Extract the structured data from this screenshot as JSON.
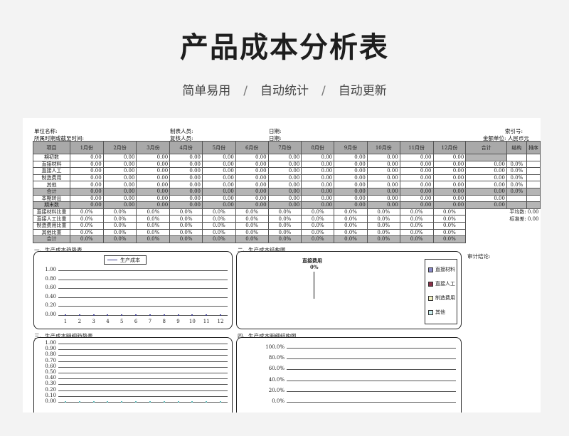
{
  "banner": {
    "title": "产品成本分析表",
    "tags": [
      "简单易用",
      "自动统计",
      "自动更新"
    ],
    "separator": "/"
  },
  "meta": {
    "unit_name": "单位名称:",
    "preparer": "制表人员:",
    "date1": "日期:",
    "index_no": "索引号:",
    "period": "所属时期或截至时间:",
    "reviewer": "复核人员:",
    "date2": "日期:",
    "currency": "金额单位: 人民币元"
  },
  "table": {
    "headers": [
      "项目",
      "1月份",
      "2月份",
      "3月份",
      "4月份",
      "5月份",
      "6月份",
      "7月份",
      "8月份",
      "9月份",
      "10月份",
      "11月份",
      "12月份",
      "合计",
      "结构",
      "排序"
    ],
    "amount_rows": [
      {
        "label": "期初数",
        "value": "0.00",
        "total": "",
        "struct": "",
        "gray": false,
        "graytotal": true
      },
      {
        "label": "直接材料",
        "value": "0.00",
        "total": "0.00",
        "struct": "0.0%",
        "gray": false,
        "graytotal": false
      },
      {
        "label": "直接人工",
        "value": "0.00",
        "total": "0.00",
        "struct": "0.0%",
        "gray": false,
        "graytotal": false
      },
      {
        "label": "制造费用",
        "value": "0.00",
        "total": "0.00",
        "struct": "0.0%",
        "gray": false,
        "graytotal": false
      },
      {
        "label": "其他",
        "value": "0.00",
        "total": "0.00",
        "struct": "0.0%",
        "gray": false,
        "graytotal": false
      },
      {
        "label": "合计",
        "value": "0.00",
        "total": "0.00",
        "struct": "0.0%",
        "gray": true,
        "graytotal": false
      },
      {
        "label": "本期转出",
        "value": "0.00",
        "total": "0.00",
        "struct": "",
        "gray": false,
        "graytotal": false
      },
      {
        "label": "期末数",
        "value": "0.00",
        "total": "0.00",
        "struct": "",
        "gray": true,
        "graytotal": false
      }
    ],
    "ratio_rows": [
      {
        "label": "直接材料比重",
        "value": "0.0%",
        "gray": false,
        "side_label": "平均数:",
        "side_value": "0.00"
      },
      {
        "label": "直接人工比重",
        "value": "0.0%",
        "gray": false,
        "side_label": "标准差:",
        "side_value": "0.00"
      },
      {
        "label": "制造费用比重",
        "value": "0.0%",
        "gray": false,
        "side_label": "",
        "side_value": ""
      },
      {
        "label": "其他比重",
        "value": "0.0%",
        "gray": false,
        "side_label": "",
        "side_value": ""
      },
      {
        "label": "合计",
        "value": "0.0%",
        "gray": true,
        "side_label": "",
        "side_value": ""
      }
    ]
  },
  "sections": {
    "s1": "一、生产成本趋势表",
    "s2": "二、生产成本结构图",
    "s3": "三、生产成本明细趋势表",
    "s4": "四、生产成本明细结构图",
    "audit": "审计结论:"
  },
  "colors": {
    "header_gray": "#a9a9a9",
    "row_gray": "#b5b5b5",
    "trend_line": "#3b3b8f",
    "detail_line": "#5fb8b8"
  },
  "chart_data": [
    {
      "type": "line",
      "title": "",
      "legend": "top-center",
      "series": [
        {
          "name": "生产成本",
          "values": [
            0,
            0,
            0,
            0,
            0,
            0,
            0,
            0,
            0,
            0,
            0,
            0
          ]
        }
      ],
      "categories": [
        "1",
        "2",
        "3",
        "4",
        "5",
        "6",
        "7",
        "8",
        "9",
        "10",
        "11",
        "12"
      ],
      "yticks": [
        "1.00",
        "0.80",
        "0.60",
        "0.40",
        "0.20",
        "0.00"
      ],
      "ylim": [
        0,
        1
      ]
    },
    {
      "type": "pie",
      "slice_label": "直接费用",
      "slice_value": "0%",
      "legend": "right",
      "legend_items": [
        {
          "name": "直接材料",
          "color": "#8a8ac8"
        },
        {
          "name": "直接人工",
          "color": "#8a3048"
        },
        {
          "name": "制造费用",
          "color": "#f0f0c0"
        },
        {
          "name": "其他",
          "color": "#c8ecec"
        }
      ]
    },
    {
      "type": "line",
      "yticks": [
        "1.00",
        "0.90",
        "0.80",
        "0.70",
        "0.60",
        "0.50",
        "0.40",
        "0.30",
        "0.20",
        "0.10",
        "0.00"
      ],
      "ylim": [
        0,
        1
      ],
      "series_values": [
        0,
        0,
        0,
        0,
        0,
        0,
        0,
        0,
        0,
        0,
        0,
        0
      ]
    },
    {
      "type": "bar",
      "yticks": [
        "100.0%",
        "80.0%",
        "60.0%",
        "40.0%",
        "20.0%",
        "0.0%"
      ],
      "ylim": [
        0,
        100
      ]
    }
  ]
}
